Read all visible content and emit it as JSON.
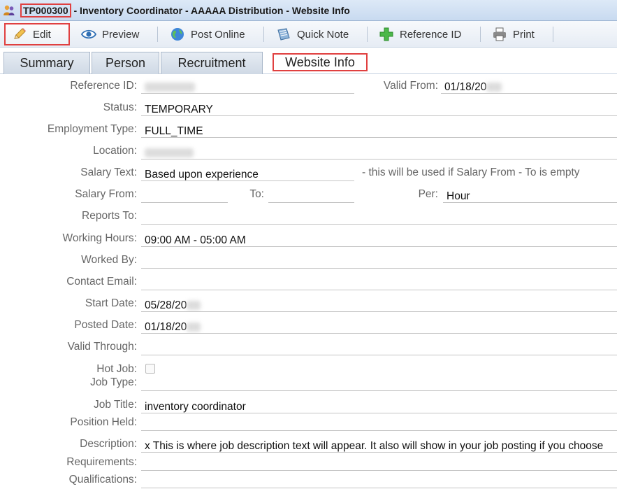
{
  "window": {
    "code": "TP000300",
    "title": " - Inventory Coordinator - AAAAA Distribution - Website Info"
  },
  "toolbar": {
    "edit": "Edit",
    "preview": "Preview",
    "post_online": "Post Online",
    "quick_note": "Quick Note",
    "reference_id": "Reference ID",
    "print": "Print"
  },
  "tabs": [
    {
      "label": "Summary"
    },
    {
      "label": "Person"
    },
    {
      "label": "Recruitment"
    },
    {
      "label": "Website Info"
    }
  ],
  "active_tab": "Website Info",
  "form": {
    "reference_id": {
      "label": "Reference ID:",
      "value": ""
    },
    "valid_from": {
      "label": "Valid From:",
      "value": "01/18/20"
    },
    "status": {
      "label": "Status:",
      "value": "TEMPORARY"
    },
    "employment_type": {
      "label": "Employment Type:",
      "value": "FULL_TIME"
    },
    "location": {
      "label": "Location:",
      "value": ""
    },
    "salary_text": {
      "label": "Salary Text:",
      "value": "Based upon experience",
      "note": "- this will be used if Salary From - To is empty"
    },
    "salary_from": {
      "label": "Salary From:",
      "value": ""
    },
    "salary_to": {
      "label": "To:",
      "value": ""
    },
    "per": {
      "label": "Per:",
      "value": "Hour"
    },
    "reports_to": {
      "label": "Reports To:",
      "value": ""
    },
    "working_hours": {
      "label": "Working Hours:",
      "value": "09:00 AM - 05:00 AM"
    },
    "worked_by": {
      "label": "Worked By:",
      "value": ""
    },
    "contact_email": {
      "label": "Contact Email:",
      "value": ""
    },
    "start_date": {
      "label": "Start Date:",
      "value": "05/28/20"
    },
    "posted_date": {
      "label": "Posted Date:",
      "value": "01/18/20"
    },
    "valid_through": {
      "label": "Valid Through:",
      "value": ""
    },
    "hot_job": {
      "label": "Hot Job:",
      "checked": false
    },
    "job_type": {
      "label": "Job Type:",
      "value": ""
    },
    "job_title": {
      "label": "Job Title:",
      "value": "inventory coordinator"
    },
    "position_held": {
      "label": "Position Held:",
      "value": ""
    },
    "description": {
      "label": "Description:",
      "value": "x This is where job description text will appear. It also will show in your job posting if you choose"
    },
    "requirements": {
      "label": "Requirements:",
      "value": ""
    },
    "qualifications": {
      "label": "Qualifications:",
      "value": ""
    }
  },
  "colors": {
    "highlight": "#e04040",
    "label": "#666666",
    "tab_active_border": "#e04040"
  }
}
